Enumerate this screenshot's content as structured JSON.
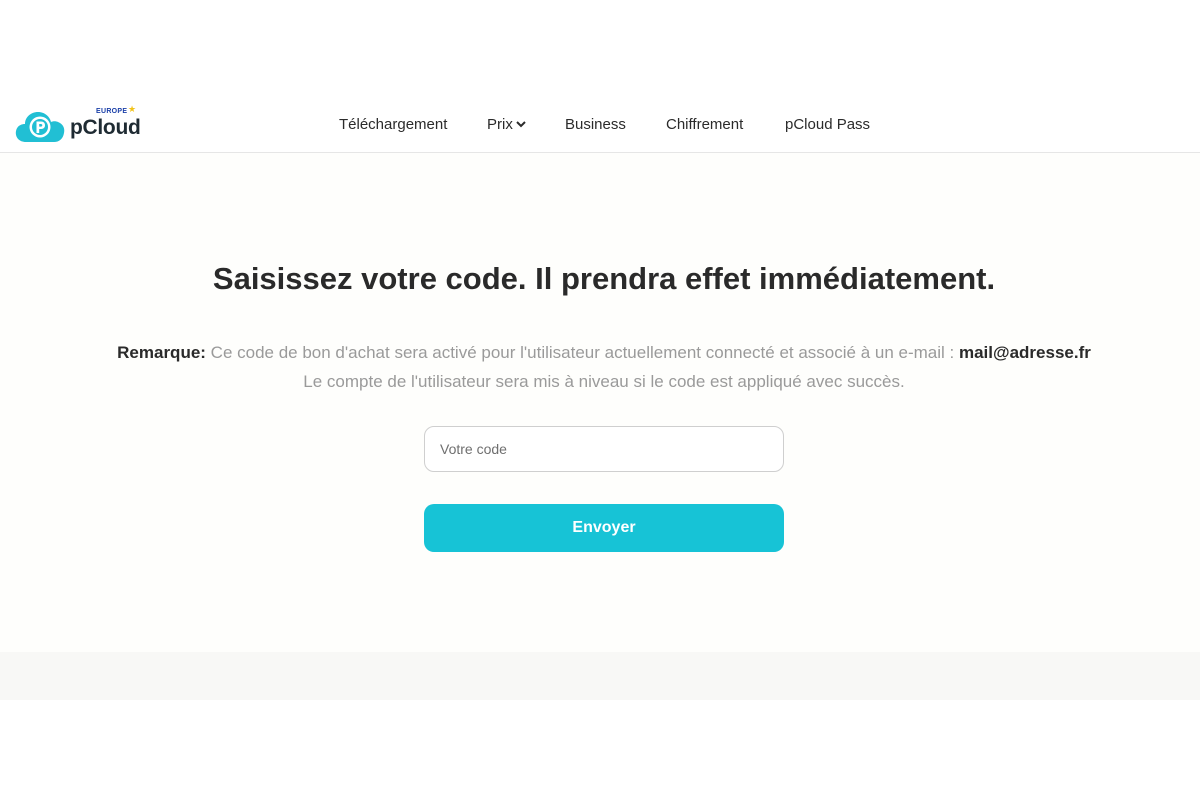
{
  "brand": {
    "name": "pCloud",
    "region": "EUROPE",
    "accent_color": "#17c3d6",
    "logo_icon": "pcloud-cloud-logo"
  },
  "nav": {
    "items": [
      {
        "label": "Téléchargement"
      },
      {
        "label": "Prix",
        "icon": "chevron-down-icon"
      },
      {
        "label": "Business"
      },
      {
        "label": "Chiffrement"
      },
      {
        "label": "pCloud Pass"
      }
    ]
  },
  "main": {
    "title": "Saisissez votre code. Il prendra effet immédiatement.",
    "note_label": "Remarque:",
    "note_text": " Ce code de bon d'achat sera activé pour l'utilisateur actuellement connecté et associé à un e-mail : ",
    "email": "mail@adresse.fr",
    "note_line2": "Le compte de l'utilisateur sera mis à niveau si le code est appliqué avec succès.",
    "input_placeholder": "Votre code",
    "input_value": "",
    "submit_label": "Envoyer"
  }
}
